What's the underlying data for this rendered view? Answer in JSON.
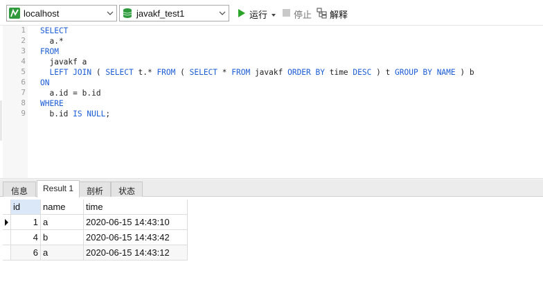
{
  "toolbar": {
    "connection": {
      "value": "localhost",
      "icon": "connection-icon"
    },
    "database": {
      "value": "javakf_test1",
      "icon": "database-icon"
    },
    "run_label": "运行",
    "stop_label": "停止",
    "explain_label": "解释"
  },
  "editor": {
    "line_numbers": [
      "1",
      "2",
      "3",
      "4",
      "5",
      "6",
      "7",
      "8",
      "9"
    ],
    "lines": [
      [
        {
          "t": "SELECT",
          "k": true
        }
      ],
      [
        {
          "t": "  a.*",
          "k": false
        }
      ],
      [
        {
          "t": "FROM",
          "k": true
        }
      ],
      [
        {
          "t": "  javakf a",
          "k": false
        }
      ],
      [
        {
          "t": "  ",
          "k": false
        },
        {
          "t": "LEFT JOIN",
          "k": true
        },
        {
          "t": " ( ",
          "k": false
        },
        {
          "t": "SELECT",
          "k": true
        },
        {
          "t": " t.* ",
          "k": false
        },
        {
          "t": "FROM",
          "k": true
        },
        {
          "t": " ( ",
          "k": false
        },
        {
          "t": "SELECT",
          "k": true
        },
        {
          "t": " * ",
          "k": false
        },
        {
          "t": "FROM",
          "k": true
        },
        {
          "t": " javakf ",
          "k": false
        },
        {
          "t": "ORDER BY",
          "k": true
        },
        {
          "t": " time ",
          "k": false
        },
        {
          "t": "DESC",
          "k": true
        },
        {
          "t": " ) t ",
          "k": false
        },
        {
          "t": "GROUP BY",
          "k": true
        },
        {
          "t": " ",
          "k": false
        },
        {
          "t": "NAME",
          "k": true
        },
        {
          "t": " ) b",
          "k": false
        }
      ],
      [
        {
          "t": "ON",
          "k": true
        }
      ],
      [
        {
          "t": "  a.id = b.id",
          "k": false
        }
      ],
      [
        {
          "t": "WHERE",
          "k": true
        }
      ],
      [
        {
          "t": "  b.id ",
          "k": false
        },
        {
          "t": "IS NULL",
          "k": true
        },
        {
          "t": ";",
          "k": false
        }
      ]
    ],
    "keyword_color": "#1a5bd6"
  },
  "tabs": [
    {
      "label": "信息",
      "active": false
    },
    {
      "label": "Result 1",
      "active": true
    },
    {
      "label": "剖析",
      "active": false
    },
    {
      "label": "状态",
      "active": false
    }
  ],
  "result": {
    "columns": [
      "id",
      "name",
      "time"
    ],
    "rows": [
      [
        "1",
        "a",
        "2020-06-15 14:43:10"
      ],
      [
        "4",
        "b",
        "2020-06-15 14:43:42"
      ],
      [
        "6",
        "a",
        "2020-06-15 14:43:12"
      ]
    ],
    "current_row": 0
  },
  "colors": {
    "run_green": "#2aa52a",
    "database_green": "#2e9a3c",
    "selected_header": "#dbe8f8"
  }
}
